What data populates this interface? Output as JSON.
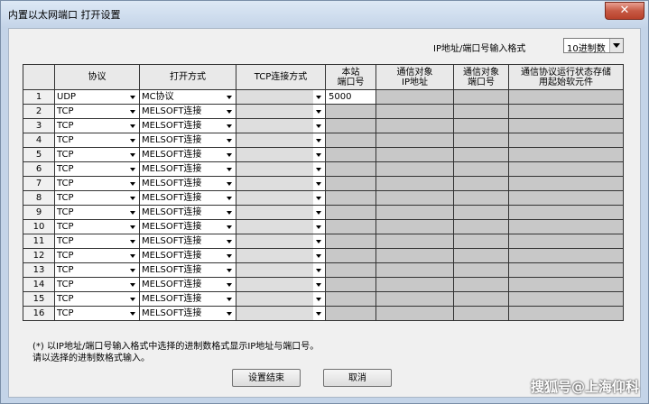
{
  "window": {
    "title": "内置以太网端口 打开设置",
    "close_label": "✕"
  },
  "format": {
    "label": "IP地址/端口号输入格式",
    "value": "10进制数"
  },
  "table": {
    "headers": {
      "rownum": "",
      "protocol": "协议",
      "open_method": "打开方式",
      "tcp_method": "TCP连接方式",
      "local_port": "本站\n端口号",
      "target_ip": "通信对象\nIP地址",
      "target_port": "通信对象\n端口号",
      "status_storage": "通信协议运行状态存储\n用起始软元件"
    },
    "rows": [
      {
        "num": "1",
        "protocol": "UDP",
        "open": "MC协议",
        "tcp": "",
        "port": "5000"
      },
      {
        "num": "2",
        "protocol": "TCP",
        "open": "MELSOFT连接",
        "tcp": "",
        "port": ""
      },
      {
        "num": "3",
        "protocol": "TCP",
        "open": "MELSOFT连接",
        "tcp": "",
        "port": ""
      },
      {
        "num": "4",
        "protocol": "TCP",
        "open": "MELSOFT连接",
        "tcp": "",
        "port": ""
      },
      {
        "num": "5",
        "protocol": "TCP",
        "open": "MELSOFT连接",
        "tcp": "",
        "port": ""
      },
      {
        "num": "6",
        "protocol": "TCP",
        "open": "MELSOFT连接",
        "tcp": "",
        "port": ""
      },
      {
        "num": "7",
        "protocol": "TCP",
        "open": "MELSOFT连接",
        "tcp": "",
        "port": ""
      },
      {
        "num": "8",
        "protocol": "TCP",
        "open": "MELSOFT连接",
        "tcp": "",
        "port": ""
      },
      {
        "num": "9",
        "protocol": "TCP",
        "open": "MELSOFT连接",
        "tcp": "",
        "port": ""
      },
      {
        "num": "10",
        "protocol": "TCP",
        "open": "MELSOFT连接",
        "tcp": "",
        "port": ""
      },
      {
        "num": "11",
        "protocol": "TCP",
        "open": "MELSOFT连接",
        "tcp": "",
        "port": ""
      },
      {
        "num": "12",
        "protocol": "TCP",
        "open": "MELSOFT连接",
        "tcp": "",
        "port": ""
      },
      {
        "num": "13",
        "protocol": "TCP",
        "open": "MELSOFT连接",
        "tcp": "",
        "port": ""
      },
      {
        "num": "14",
        "protocol": "TCP",
        "open": "MELSOFT连接",
        "tcp": "",
        "port": ""
      },
      {
        "num": "15",
        "protocol": "TCP",
        "open": "MELSOFT连接",
        "tcp": "",
        "port": ""
      },
      {
        "num": "16",
        "protocol": "TCP",
        "open": "MELSOFT连接",
        "tcp": "",
        "port": ""
      }
    ]
  },
  "notes": {
    "line1": "(*) 以IP地址/端口号输入格式中选择的进制数格式显示IP地址与端口号。",
    "line2": "请以选择的进制数格式输入。"
  },
  "buttons": {
    "ok": "设置结束",
    "cancel": "取消"
  },
  "watermark": "搜狐号@上海仰科"
}
